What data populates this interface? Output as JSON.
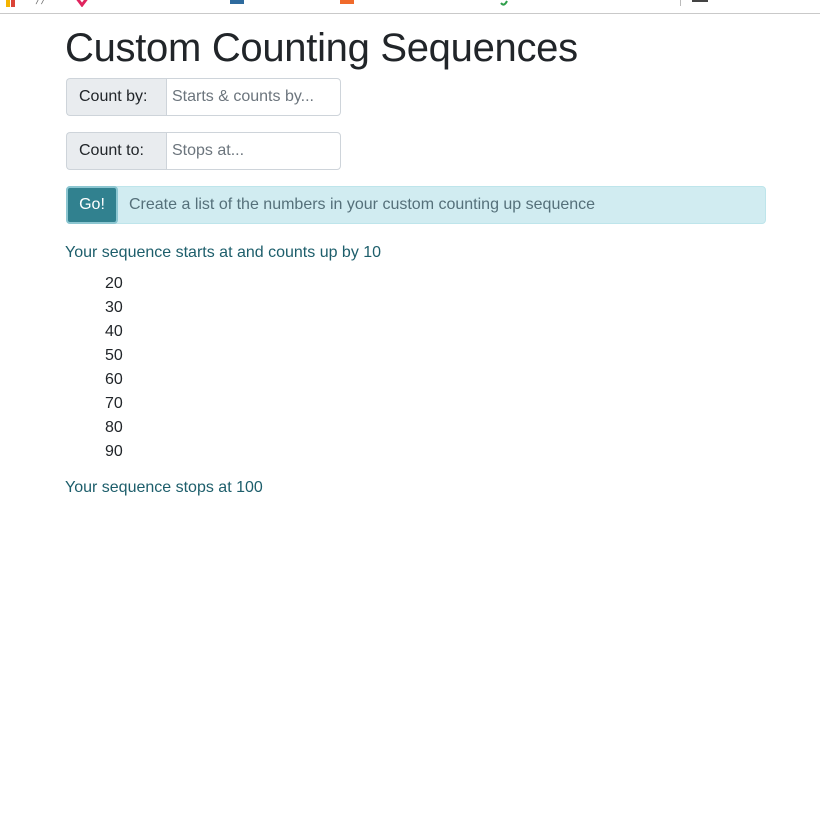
{
  "page": {
    "title": "Custom Counting Sequences"
  },
  "count_by": {
    "label": "Count by:",
    "value": "",
    "placeholder": "Starts & counts by..."
  },
  "count_to": {
    "label": "Count to:",
    "value": "",
    "placeholder": "Stops at..."
  },
  "go": {
    "button_label": "Go!",
    "hint": "Create a list of the numbers in your custom counting up sequence"
  },
  "result": {
    "start_text": "Your sequence starts at and counts up by 10",
    "items": [
      "20",
      "30",
      "40",
      "50",
      "60",
      "70",
      "80",
      "90"
    ],
    "stop_text": "Your sequence stops at 100"
  },
  "colors": {
    "accent": "#31818f",
    "info_bg": "#d1ecf1",
    "result_text": "#1d5e6b"
  }
}
